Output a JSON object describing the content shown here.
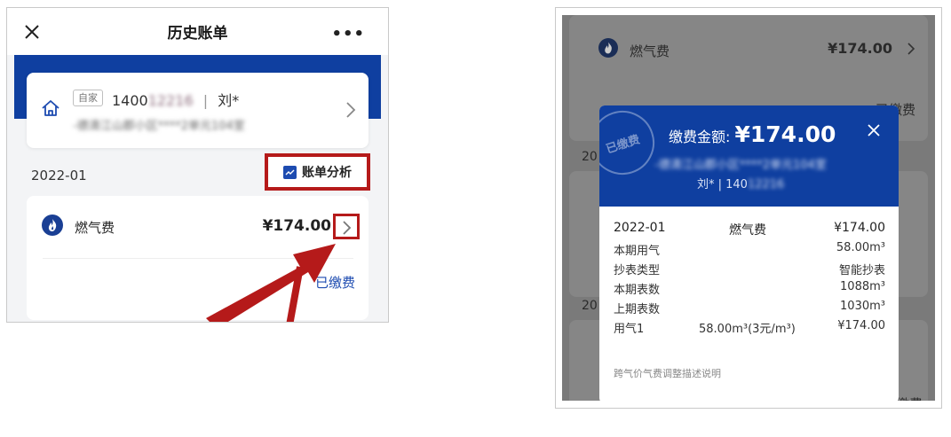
{
  "left": {
    "header": {
      "title": "历史账单",
      "more_label": "•••"
    },
    "account": {
      "tag": "自家",
      "account_no_prefix": "1400",
      "account_no_masked": "12216",
      "separator": "|",
      "owner": "刘*",
      "address_masked": "-德清江山郡小区****2单元104室"
    },
    "period": "2022-01",
    "analysis_label": "账单分析",
    "bill": {
      "name": "燃气费",
      "amount": "¥174.00",
      "status": "已缴费"
    }
  },
  "right": {
    "background": {
      "name": "燃气费",
      "amount": "¥174.00",
      "status": "已缴费",
      "period_fragment": "20"
    },
    "modal": {
      "stamp_text": "已缴费",
      "amount_label": "缴费金额:",
      "amount": "¥174.00",
      "address_masked": "-德清江山郡小区****2单元104室",
      "user_prefix": "刘* | 140",
      "user_masked": "12216",
      "rows": [
        {
          "label": "2022-01",
          "middle": "燃气费",
          "value": "¥174.00"
        },
        {
          "label": "本期用气",
          "middle": "",
          "value": "58.00m³"
        },
        {
          "label": "抄表类型",
          "middle": "",
          "value": "智能抄表"
        },
        {
          "label": "本期表数",
          "middle": "",
          "value": "1088m³"
        },
        {
          "label": "上期表数",
          "middle": "",
          "value": "1030m³"
        },
        {
          "label": "用气1",
          "middle": "58.00m³(3元/m³)",
          "value": "¥174.00"
        }
      ],
      "footer_note": "跨气价气费调整描述说明"
    }
  },
  "colors": {
    "brand_blue": "#0f3fa0",
    "highlight_red": "#b51a1a",
    "link_blue": "#1d4bb0"
  }
}
